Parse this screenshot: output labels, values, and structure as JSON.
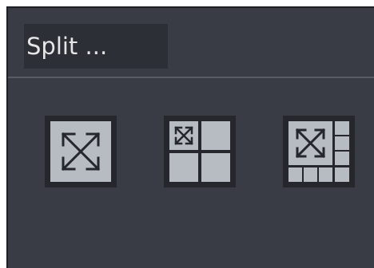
{
  "dialog": {
    "title": "Split ..."
  },
  "split_options": [
    {
      "name": "single-view",
      "icon": "expand-arrows-icon",
      "panes": 1
    },
    {
      "name": "four-view",
      "icon": "grid-4-icon",
      "panes": 4
    },
    {
      "name": "eight-view",
      "icon": "grid-8-icon",
      "panes": 8
    }
  ],
  "colors": {
    "panel_bg": "#393c45",
    "tile_bg": "#25272d",
    "cell_fill": "#b7bbc2",
    "arrow": "#25272d"
  }
}
